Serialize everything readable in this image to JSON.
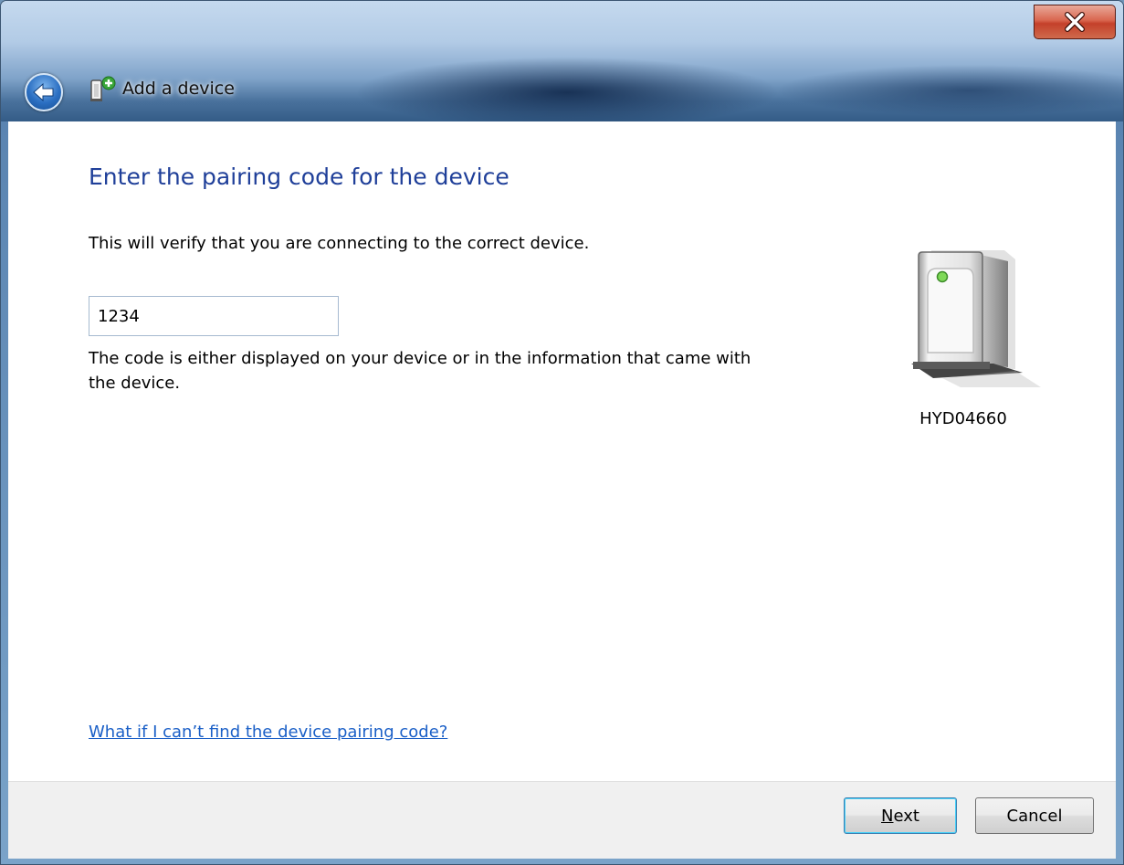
{
  "window": {
    "title": "Add a device",
    "close_label": "X"
  },
  "page": {
    "heading": "Enter the pairing code for the device",
    "verify_text": "This will verify that you are connecting to the correct device.",
    "code_value": "1234",
    "hint_text": "The code is either displayed on your device or in the information that came with the device.",
    "help_link": "What if I can’t find the device pairing code?"
  },
  "device": {
    "name": "HYD04660",
    "icon": "device-tower-icon"
  },
  "footer": {
    "next_first": "N",
    "next_rest": "ext",
    "cancel_label": "Cancel"
  },
  "icons": {
    "back": "back-arrow-icon",
    "title": "add-device-icon",
    "close": "close-icon"
  },
  "colors": {
    "heading": "#1f3f99",
    "link": "#1a5fc7",
    "close_button": "#c4402a"
  }
}
